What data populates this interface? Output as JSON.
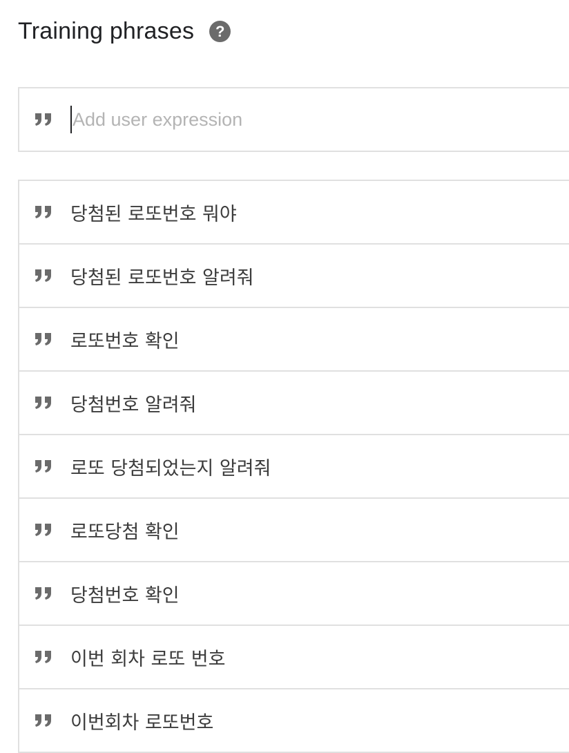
{
  "section": {
    "title": "Training phrases",
    "help_icon": "question-circle-icon"
  },
  "add_expression": {
    "placeholder": "Add user expression",
    "icon": "quote-icon"
  },
  "phrases": [
    {
      "text": "당첨된 로또번호 뭐야"
    },
    {
      "text": "당첨된 로또번호 알려줘"
    },
    {
      "text": "로또번호 확인"
    },
    {
      "text": "당첨번호 알려줘"
    },
    {
      "text": "로또 당첨되었는지 알려줘"
    },
    {
      "text": "로또당첨 확인"
    },
    {
      "text": "당첨번호 확인"
    },
    {
      "text": "이번 회차 로또 번호"
    },
    {
      "text": "이번회차 로또번호"
    }
  ],
  "colors": {
    "icon_gray": "#6b6b6b",
    "border": "#e0e0e0",
    "text": "#3c3c3c"
  }
}
